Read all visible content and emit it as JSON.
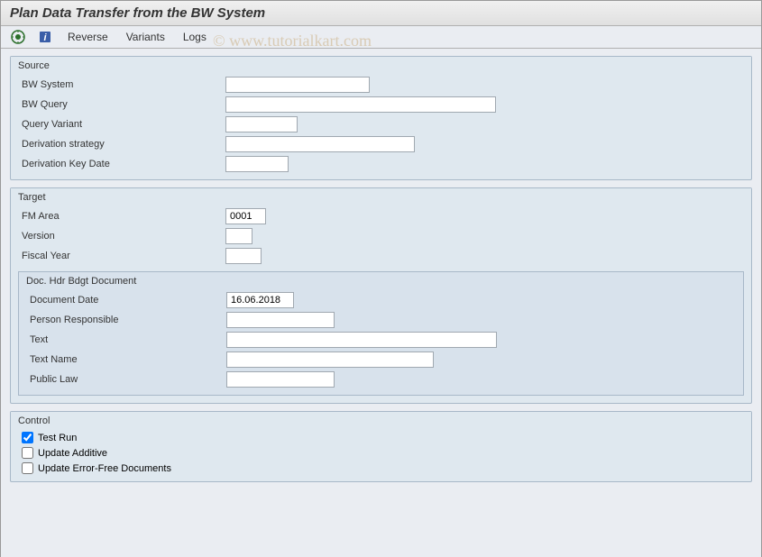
{
  "title": "Plan Data Transfer from the BW System",
  "toolbar": {
    "reverse": "Reverse",
    "variants": "Variants",
    "logs": "Logs"
  },
  "watermark": "© www.tutorialkart.com",
  "watermark2": "tutorialkart",
  "source": {
    "legend": "Source",
    "bw_system_label": "BW System",
    "bw_system_value": "",
    "bw_query_label": "BW Query",
    "bw_query_value": "",
    "query_variant_label": "Query Variant",
    "query_variant_value": "",
    "derivation_strategy_label": "Derivation strategy",
    "derivation_strategy_value": "",
    "derivation_key_date_label": "Derivation Key Date",
    "derivation_key_date_value": ""
  },
  "target": {
    "legend": "Target",
    "fm_area_label": "FM Area",
    "fm_area_value": "0001",
    "version_label": "Version",
    "version_value": "",
    "fiscal_year_label": "Fiscal Year",
    "fiscal_year_value": "",
    "doc_hdr": {
      "legend": "Doc. Hdr Bdgt Document",
      "document_date_label": "Document Date",
      "document_date_value": "16.06.2018",
      "person_responsible_label": "Person Responsible",
      "person_responsible_value": "",
      "text_label": "Text",
      "text_value": "",
      "text_name_label": "Text Name",
      "text_name_value": "",
      "public_law_label": "Public Law",
      "public_law_value": ""
    }
  },
  "control": {
    "legend": "Control",
    "test_run_label": "Test Run",
    "update_additive_label": "Update Additive",
    "update_error_free_label": "Update Error-Free Documents"
  }
}
